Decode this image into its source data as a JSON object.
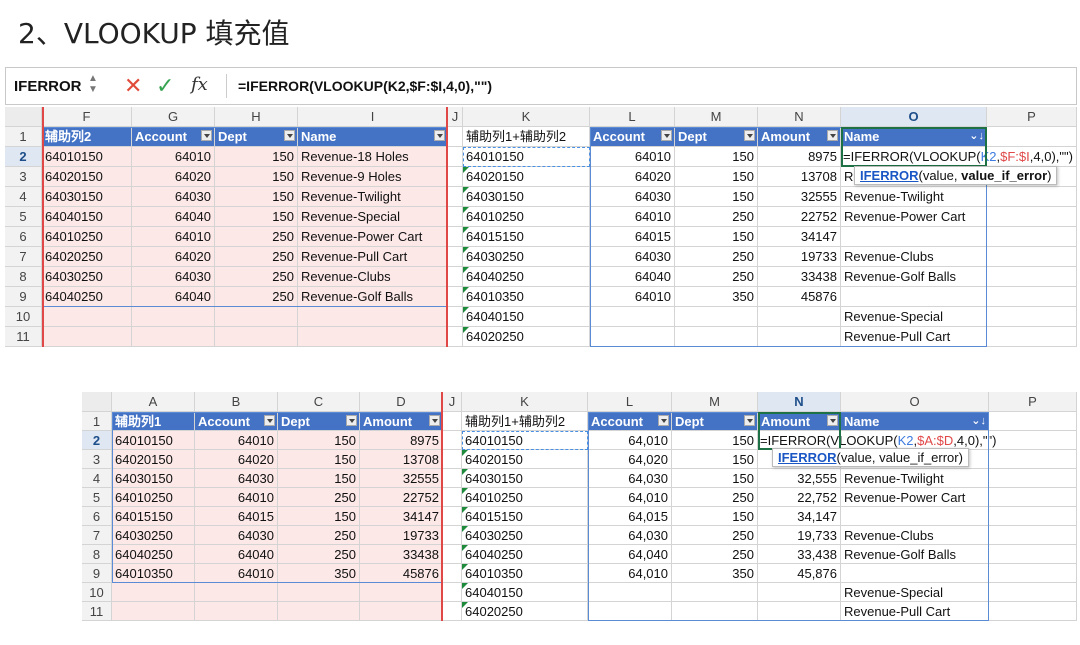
{
  "title": "2、VLOOKUP 填充值",
  "top": {
    "name_box": "IFERROR",
    "formula": "=IFERROR(VLOOKUP(K2,$F:$I,4,0),\"\")",
    "cols": [
      "F",
      "G",
      "H",
      "I",
      "J",
      "K",
      "L",
      "M",
      "N",
      "O",
      "P"
    ],
    "rows": [
      "1",
      "2",
      "3",
      "4",
      "5",
      "6",
      "7",
      "8",
      "9",
      "10",
      "11"
    ],
    "headers": {
      "F": "辅助列2",
      "G": "Account",
      "H": "Dept",
      "I": "Name",
      "K": "辅助列1+辅助列2",
      "L": "Account",
      "M": "Dept",
      "N": "Amount",
      "O": "Name"
    },
    "left": [
      [
        "64010150",
        "64010",
        "150",
        "Revenue-18 Holes"
      ],
      [
        "64020150",
        "64020",
        "150",
        "Revenue-9 Holes"
      ],
      [
        "64030150",
        "64030",
        "150",
        "Revenue-Twilight"
      ],
      [
        "64040150",
        "64040",
        "150",
        "Revenue-Special"
      ],
      [
        "64010250",
        "64010",
        "250",
        "Revenue-Power Cart"
      ],
      [
        "64020250",
        "64020",
        "250",
        "Revenue-Pull Cart"
      ],
      [
        "64030250",
        "64030",
        "250",
        "Revenue-Clubs"
      ],
      [
        "64040250",
        "64040",
        "250",
        "Revenue-Golf Balls"
      ]
    ],
    "right": [
      [
        "64010150",
        "64010",
        "150",
        "8975",
        ""
      ],
      [
        "64020150",
        "64020",
        "150",
        "13708",
        "R"
      ],
      [
        "64030150",
        "64030",
        "150",
        "32555",
        "Revenue-Twilight"
      ],
      [
        "64010250",
        "64010",
        "250",
        "22752",
        "Revenue-Power Cart"
      ],
      [
        "64015150",
        "64015",
        "150",
        "34147",
        ""
      ],
      [
        "64030250",
        "64030",
        "250",
        "19733",
        "Revenue-Clubs"
      ],
      [
        "64040250",
        "64040",
        "250",
        "33438",
        "Revenue-Golf Balls"
      ],
      [
        "64010350",
        "64010",
        "350",
        "45876",
        ""
      ],
      [
        "64040150",
        "",
        "",
        "",
        "Revenue-Special"
      ],
      [
        "64020250",
        "",
        "",
        "",
        "Revenue-Pull Cart"
      ]
    ],
    "edit": {
      "a": "=IFERROR(VLOOKUP(",
      "b": "K2",
      "c": ",",
      "d": "$F:$I",
      "e": ",4,0),\"\")"
    },
    "tip": {
      "fn": "IFERROR",
      "args1": "(value, ",
      "args2": "value_if_error",
      ")": ")"
    }
  },
  "bottom": {
    "cols": [
      "A",
      "B",
      "C",
      "D",
      "J",
      "K",
      "L",
      "M",
      "N",
      "O",
      "P"
    ],
    "rows": [
      "1",
      "2",
      "3",
      "4",
      "5",
      "6",
      "7",
      "8",
      "9",
      "10",
      "11"
    ],
    "headers": {
      "A": "辅助列1",
      "B": "Account",
      "C": "Dept",
      "D": "Amount",
      "K": "辅助列1+辅助列2",
      "L": "Account",
      "M": "Dept",
      "N": "Amount",
      "O": "Name"
    },
    "left": [
      [
        "64010150",
        "64010",
        "150",
        "8975"
      ],
      [
        "64020150",
        "64020",
        "150",
        "13708"
      ],
      [
        "64030150",
        "64030",
        "150",
        "32555"
      ],
      [
        "64010250",
        "64010",
        "250",
        "22752"
      ],
      [
        "64015150",
        "64015",
        "150",
        "34147"
      ],
      [
        "64030250",
        "64030",
        "250",
        "19733"
      ],
      [
        "64040250",
        "64040",
        "250",
        "33438"
      ],
      [
        "64010350",
        "64010",
        "350",
        "45876"
      ]
    ],
    "right": [
      [
        "64010150",
        "64,010",
        "150",
        "",
        ""
      ],
      [
        "64020150",
        "64,020",
        "150",
        "",
        ""
      ],
      [
        "64030150",
        "64,030",
        "150",
        "32,555",
        "Revenue-Twilight"
      ],
      [
        "64010250",
        "64,010",
        "250",
        "22,752",
        "Revenue-Power Cart"
      ],
      [
        "64015150",
        "64,015",
        "150",
        "34,147",
        ""
      ],
      [
        "64030250",
        "64,030",
        "250",
        "19,733",
        "Revenue-Clubs"
      ],
      [
        "64040250",
        "64,040",
        "250",
        "33,438",
        "Revenue-Golf Balls"
      ],
      [
        "64010350",
        "64,010",
        "350",
        "45,876",
        ""
      ],
      [
        "64040150",
        "",
        "",
        "",
        "Revenue-Special"
      ],
      [
        "64020250",
        "",
        "",
        "",
        "Revenue-Pull Cart"
      ]
    ],
    "edit": {
      "a": "=IFERROR(VLOOKUP(",
      "b": "K2",
      "c": ",",
      "d": "$A:$D",
      "e": ",4,0),\"\")"
    },
    "tip": {
      "fn": "IFERROR",
      "args": "(value, value_if_error)"
    }
  },
  "colors": {
    "header_blue": "#4472c4",
    "highlight_pink": "#fde8e8",
    "ref_red": "#e04848",
    "ref_blue": "#3d7be0",
    "cancel": "#e04b3a",
    "confirm": "#35a34f"
  }
}
